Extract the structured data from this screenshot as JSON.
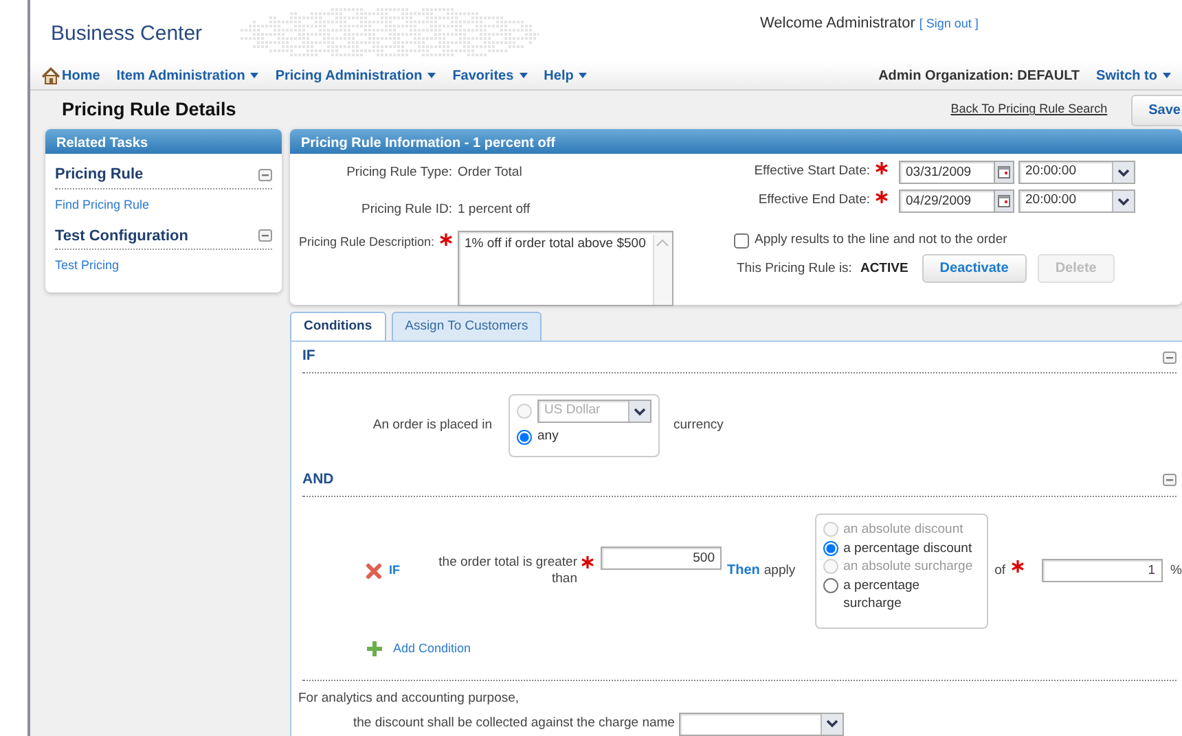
{
  "header": {
    "title": "Business Center",
    "welcome": "Welcome Administrator",
    "sign_out": "[ Sign out ]"
  },
  "nav": {
    "items": [
      {
        "label": "Home",
        "kind": "home"
      },
      {
        "label": "Item Administration",
        "kind": "menu"
      },
      {
        "label": "Pricing Administration",
        "kind": "menu"
      },
      {
        "label": "Favorites",
        "kind": "menu"
      },
      {
        "label": "Help",
        "kind": "menu"
      }
    ],
    "org": "Admin Organization: DEFAULT",
    "switch": "Switch to"
  },
  "page": {
    "title": "Pricing Rule Details",
    "back_link": "Back To Pricing Rule Search",
    "save": "Save"
  },
  "related_tasks": {
    "title": "Related Tasks",
    "groups": [
      {
        "title": "Pricing Rule",
        "links": [
          "Find Pricing Rule"
        ]
      },
      {
        "title": "Test Configuration",
        "links": [
          "Test Pricing"
        ]
      }
    ]
  },
  "info": {
    "title": "Pricing Rule Information - 1 percent off",
    "type_label": "Pricing Rule Type:",
    "type": "Order Total",
    "id_label": "Pricing Rule ID:",
    "id": "1 percent off",
    "desc_label": "Pricing Rule Description:",
    "description": "1% off if order total above $500",
    "dates": [
      {
        "label": "Effective Start Date:",
        "date": "03/31/2009",
        "time": "20:00:00"
      },
      {
        "label": "Effective End Date:",
        "date": "04/29/2009",
        "time": "20:00:00"
      }
    ],
    "apply_label": "Apply results to the line and not to the order",
    "apply_checked": false,
    "status_label": "This Pricing Rule is:",
    "status": "ACTIVE",
    "buttons": [
      {
        "label": "Deactivate",
        "disabled": false
      },
      {
        "label": "Delete",
        "disabled": true
      }
    ]
  },
  "tabs": [
    {
      "label": "Conditions",
      "selected": true
    },
    {
      "label": "Assign To Customers",
      "selected": false
    }
  ],
  "if_section": {
    "title": "IF",
    "label": "An order is placed in",
    "options": [
      {
        "kind": "select",
        "value": "US Dollar",
        "selected": false
      },
      {
        "kind": "plain",
        "label": "any",
        "selected": true
      }
    ],
    "suffix": "currency"
  },
  "and_section": {
    "title": "AND",
    "if": "IF",
    "label": "the order total is greater than",
    "value": "500",
    "then": "Then",
    "apply": "apply",
    "options": [
      {
        "label": "an absolute discount",
        "selected": false,
        "disabled": true
      },
      {
        "label": "a percentage discount",
        "selected": true,
        "disabled": false
      },
      {
        "label": "an absolute surcharge",
        "selected": false,
        "disabled": true
      },
      {
        "label": "a percentage surcharge",
        "selected": false,
        "disabled": false
      }
    ],
    "of": "of",
    "amount": "1",
    "unit": "%",
    "add": "Add Condition"
  },
  "charge": {
    "line1": "For analytics and accounting purpose,",
    "line2": "the discount shall be collected against the charge name"
  }
}
